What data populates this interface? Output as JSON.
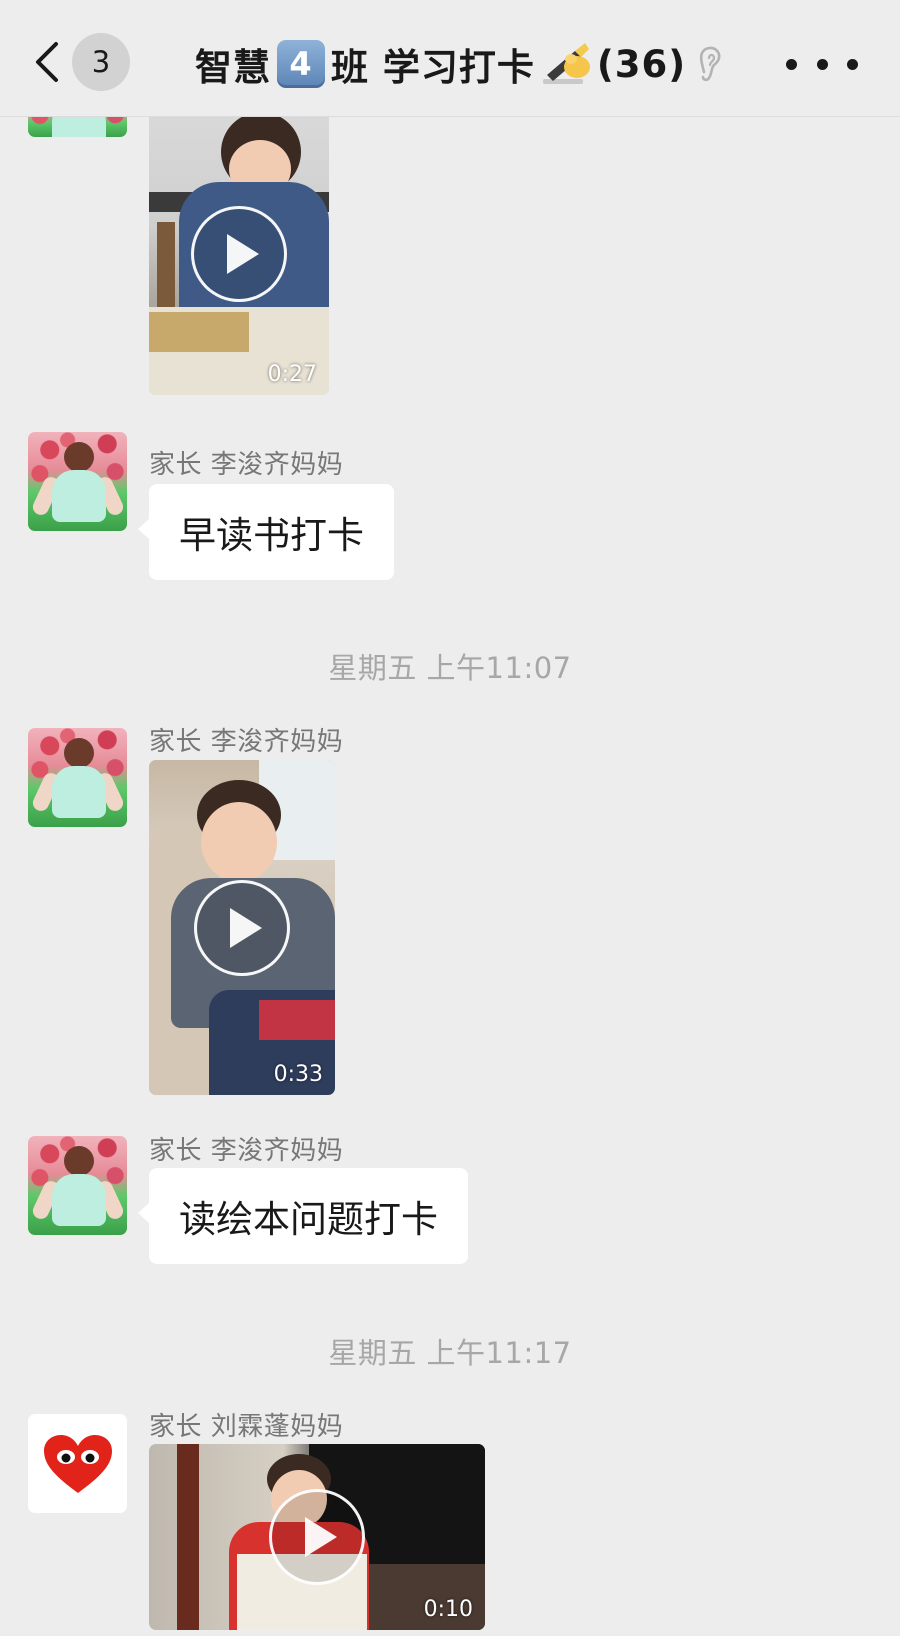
{
  "header": {
    "unread_count": "3",
    "title_prefix": "智慧",
    "title_keycap": "4",
    "title_suffix": "班 学习打卡",
    "member_count": "(36)",
    "icons": {
      "back": "chevron-left-icon",
      "writing": "writing-hand-emoji",
      "earpiece": "ear-icon",
      "more": "more-dots-icon"
    }
  },
  "messages": [
    {
      "type": "video",
      "duration": "0:27"
    },
    {
      "type": "text",
      "sender": "家长 李浚齐妈妈",
      "text": "早读书打卡"
    },
    {
      "type": "time",
      "text": "星期五 上午11:07"
    },
    {
      "type": "video",
      "sender": "家长 李浚齐妈妈",
      "duration": "0:33"
    },
    {
      "type": "text",
      "sender": "家长 李浚齐妈妈",
      "text": "读绘本问题打卡"
    },
    {
      "type": "time",
      "text": "星期五 上午11:17"
    },
    {
      "type": "video",
      "sender": "家长 刘霖蓬妈妈",
      "duration": "0:10"
    }
  ],
  "colors": {
    "background": "#ededed",
    "bubble": "#ffffff",
    "sender_text": "#777777",
    "timestamp_text": "#a7a7a7",
    "heart_red": "#e2231a"
  }
}
